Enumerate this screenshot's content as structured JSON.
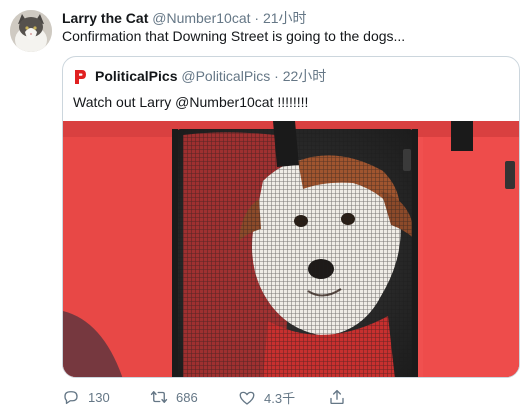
{
  "tweet": {
    "author_name": "Larry the Cat",
    "author_handle": "@Number10cat",
    "separator": "·",
    "time": "21小时",
    "text": "Confirmation that Downing Street is going to the dogs..."
  },
  "quoted_tweet": {
    "author_name": "PoliticalPics",
    "author_handle": "@PoliticalPics",
    "separator": "·",
    "time": "22小时",
    "text": "Watch out Larry @Number10cat !!!!!!!!",
    "logo_color": "#e02020"
  },
  "actions": {
    "reply_count": "130",
    "retweet_count": "686",
    "like_count": "4.3千",
    "share_label": ""
  },
  "colors": {
    "text_primary": "#14171a",
    "text_secondary": "#657786",
    "border": "#ccd6dd"
  }
}
